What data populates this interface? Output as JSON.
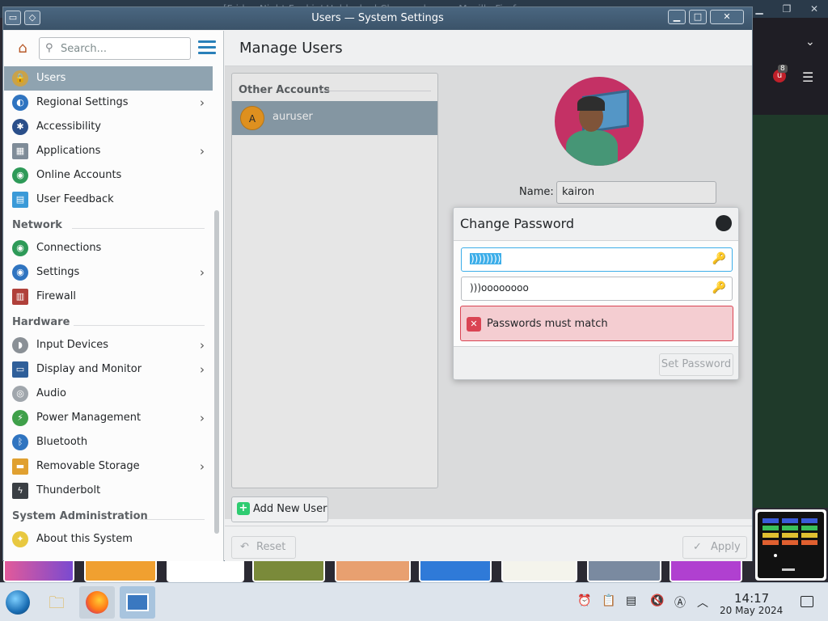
{
  "background_window": {
    "title": "[Friday Night Funkin' Unblocked Classwork.cc — Mozilla Firefox",
    "extension_badge": "8"
  },
  "window": {
    "title": "Users — System Settings"
  },
  "sidebar": {
    "search_placeholder": "Search...",
    "items_top": [
      {
        "label": "Users"
      },
      {
        "label": "Regional Settings"
      },
      {
        "label": "Accessibility"
      },
      {
        "label": "Applications"
      },
      {
        "label": "Online Accounts"
      },
      {
        "label": "User Feedback"
      }
    ],
    "network_heading": "Network",
    "network_items": [
      {
        "label": "Connections"
      },
      {
        "label": "Settings"
      },
      {
        "label": "Firewall"
      }
    ],
    "hardware_heading": "Hardware",
    "hardware_items": [
      {
        "label": "Input Devices"
      },
      {
        "label": "Display and Monitor"
      },
      {
        "label": "Audio"
      },
      {
        "label": "Power Management"
      },
      {
        "label": "Bluetooth"
      },
      {
        "label": "Removable Storage"
      },
      {
        "label": "Thunderbolt"
      }
    ],
    "sysadmin_heading": "System Administration",
    "sysadmin_items": [
      {
        "label": "About this System"
      }
    ]
  },
  "main": {
    "title": "Manage Users",
    "accounts_header": "Other Accounts",
    "account": {
      "initial": "A",
      "name": "auruser"
    },
    "name_label": "Name:",
    "name_value": "kairon",
    "add_user_label": "Add New User",
    "reset_label": "Reset",
    "apply_label": "Apply"
  },
  "dialog": {
    "title": "Change Password",
    "password_value": "))))))))",
    "confirm_value": ")))oooooooo",
    "error_message": "Passwords must match",
    "set_password_label": "Set Password"
  },
  "taskbar": {
    "time": "14:17",
    "date": "20 May 2024"
  }
}
